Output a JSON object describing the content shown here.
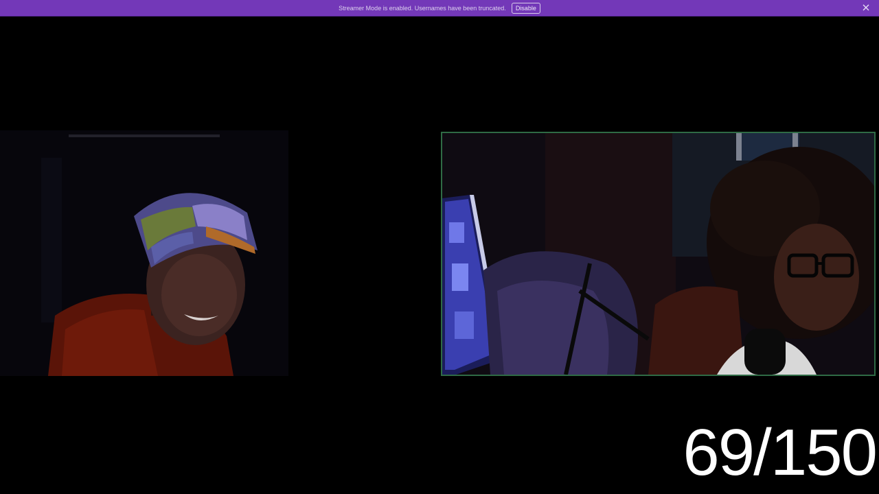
{
  "banner": {
    "message": "Streamer Mode is enabled. Usernames have been truncated.",
    "button_label": "Disable",
    "close_icon": "close-icon",
    "background": "#7338b8"
  },
  "video_tiles": [
    {
      "id": "participant-left",
      "active_speaker": false
    },
    {
      "id": "participant-right",
      "active_speaker": true,
      "border_color": "#2f6b45"
    }
  ],
  "counter": {
    "text": "69/150"
  }
}
